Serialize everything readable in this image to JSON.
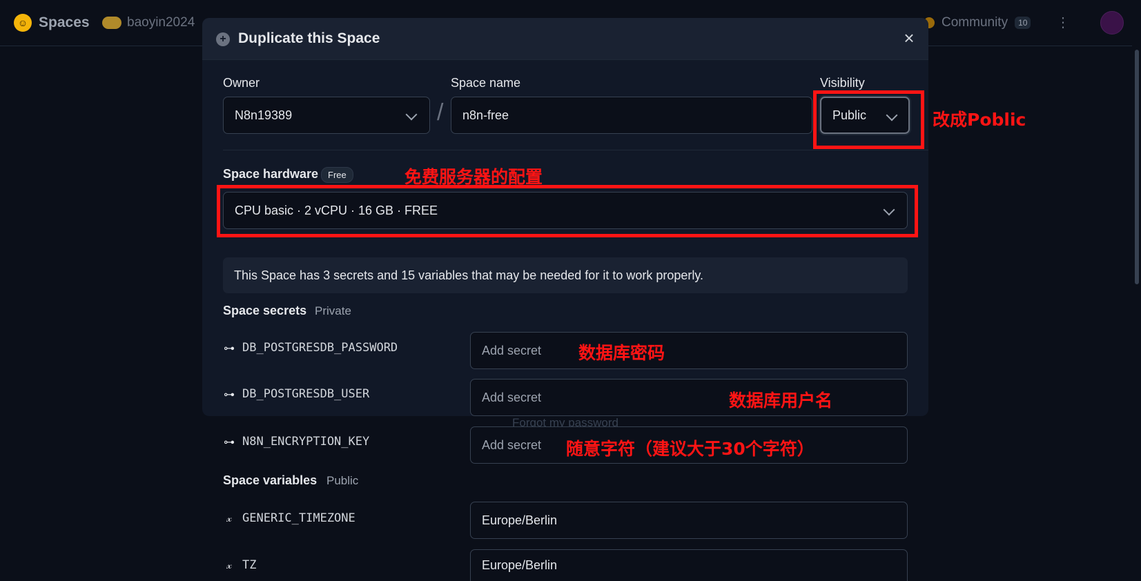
{
  "topbar": {
    "brand": "Spaces",
    "user": "baoyin2024",
    "community": "Community",
    "community_count": "10"
  },
  "background": {
    "ghost_text": "Forgot my password"
  },
  "modal": {
    "title": "Duplicate this Space",
    "close": "×",
    "owner": {
      "label": "Owner",
      "value": "N8n19389"
    },
    "slash": "/",
    "space_name": {
      "label": "Space name",
      "value": "n8n-free"
    },
    "visibility": {
      "label": "Visibility",
      "value": "Public"
    },
    "hardware": {
      "label": "Space hardware",
      "badge": "Free",
      "value": "CPU basic · 2 vCPU · 16 GB · FREE"
    },
    "info": "This Space has 3 secrets and 15 variables that may be needed for it to work properly.",
    "secrets": {
      "label": "Space secrets",
      "sub": "Private",
      "items": [
        {
          "name": "DB_POSTGRESDB_PASSWORD",
          "placeholder": "Add secret"
        },
        {
          "name": "DB_POSTGRESDB_USER",
          "placeholder": "Add secret"
        },
        {
          "name": "N8N_ENCRYPTION_KEY",
          "placeholder": "Add secret"
        }
      ]
    },
    "variables": {
      "label": "Space variables",
      "sub": "Public",
      "items": [
        {
          "name": "GENERIC_TIMEZONE",
          "value": "Europe/Berlin"
        },
        {
          "name": "TZ",
          "value": "Europe/Berlin"
        }
      ]
    }
  },
  "annotations": {
    "visibility": "改成Poblic",
    "hardware": "免费服务器的配置",
    "password": "数据库密码",
    "user": "数据库用户名",
    "key": "随意字符（建议大于30个字符）"
  },
  "colors": {
    "annotation": "#ff1414",
    "modal_bg": "#111827",
    "page_bg": "#0b0f19"
  }
}
